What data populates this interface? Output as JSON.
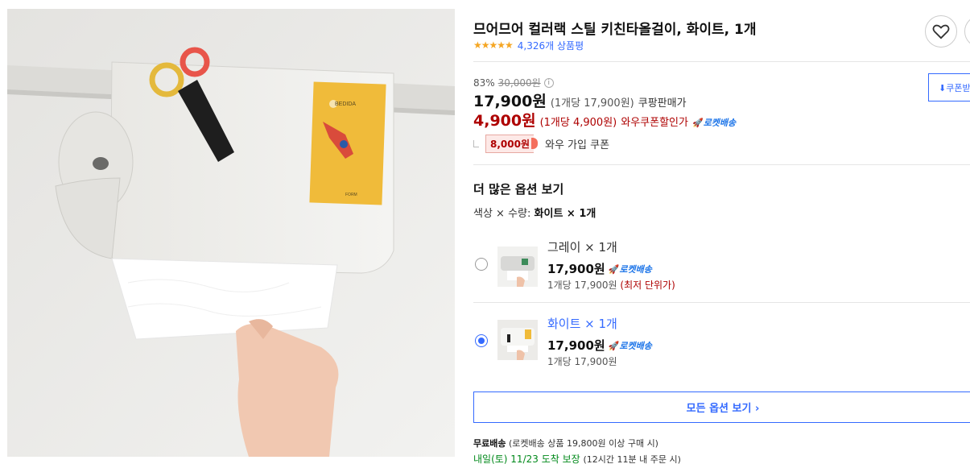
{
  "product": {
    "title": "므어므어 컬러랙 스틸 키친타올걸이, 화이트, 1개",
    "stars": "★★★★★",
    "review_count": "4,326개 상품평"
  },
  "price": {
    "discount_rate": "83%",
    "original_price": "30,000원",
    "sale_price": "17,900원",
    "sale_unit_price": "(1개당 17,900원)",
    "sale_price_type": "쿠팡판매가",
    "coupon_price": "4,900원",
    "coupon_unit_price": "(1개당 4,900원)",
    "coupon_price_type": "와우쿠폰할인가",
    "rocket_label": "로켓배송",
    "wow_coupon_amount": "8,000원",
    "wow_coupon_label": "와우 가입 쿠폰",
    "coupon_button_label": "쿠폰받"
  },
  "options": {
    "heading": "더 많은 옵션 보기",
    "summary_prefix": "색상 × 수량:",
    "summary_value": "화이트 × 1개",
    "items": [
      {
        "name": "그레이 × 1개",
        "price": "17,900원",
        "rocket": "로켓배송",
        "unit": "1개당 17,900원",
        "lowest": "(최저 단위가)",
        "selected": false
      },
      {
        "name": "화이트 × 1개",
        "price": "17,900원",
        "rocket": "로켓배송",
        "unit": "1개당 17,900원",
        "selected": true
      }
    ],
    "all_button": "모든 옵션 보기 ›"
  },
  "shipping": {
    "free_label": "무료배송",
    "free_condition": "(로켓배송 상품 19,800원 이상 구매 시)",
    "arrival": "내일(토) 11/23 도착 보장",
    "arrival_condition": "(12시간 11분 내 주문 시)"
  },
  "image": {
    "card_brand": "BEDIDA",
    "card_footer": "FORM"
  },
  "colors": {
    "accent_blue": "#346aff",
    "price_red": "#ae0000",
    "star_orange": "#f5a623",
    "arrival_green": "#00891a"
  }
}
